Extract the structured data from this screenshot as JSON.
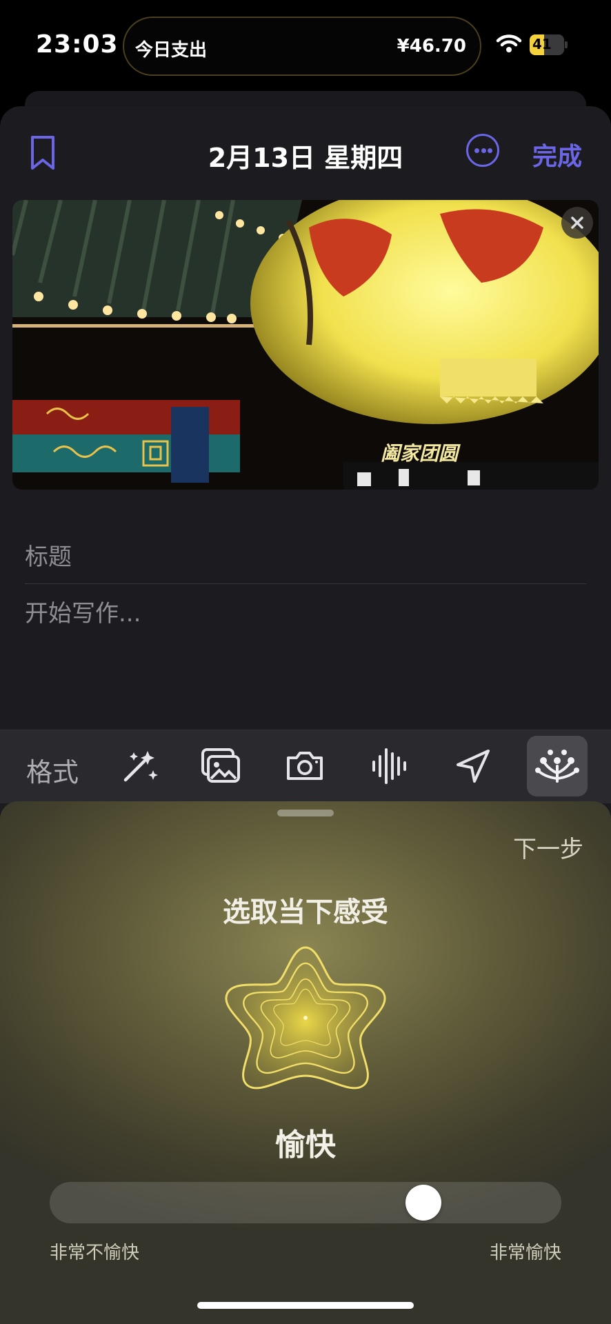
{
  "status": {
    "time": "23:03",
    "battery": "41",
    "battery_level": 0.41
  },
  "live_activity": {
    "label": "今日支出",
    "amount": "¥46.70"
  },
  "header": {
    "date": "2月13日 星期四",
    "done_label": "完成"
  },
  "photo": {
    "caption": "阖家团圆"
  },
  "editor": {
    "title_placeholder": "标题",
    "body_placeholder": "开始写作..."
  },
  "toolbar": {
    "format_label": "格式",
    "tools": [
      "magic-wand-icon",
      "photos-icon",
      "camera-icon",
      "audio-waveform-icon",
      "location-arrow-icon",
      "state-of-mind-icon"
    ]
  },
  "mood": {
    "next_label": "下一步",
    "prompt": "选取当下感受",
    "selected": "愉快",
    "slider_min_label": "非常不愉快",
    "slider_max_label": "非常愉快",
    "slider_value": 0.75
  },
  "colors": {
    "accent": "#6b66e6",
    "mood_yellow": "#f5e04a",
    "battery": "#f5d13c"
  }
}
